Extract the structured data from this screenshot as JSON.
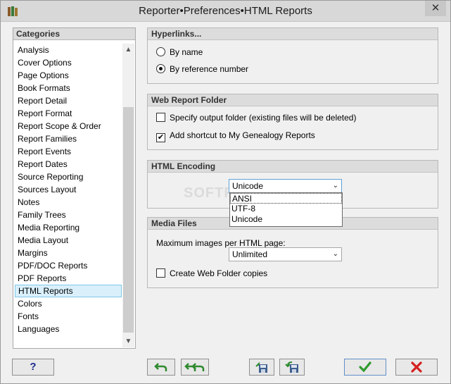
{
  "window": {
    "title": "Reporter•Preferences•HTML Reports",
    "close_label": "✕"
  },
  "categories": {
    "header": "Categories",
    "items": [
      "Analysis",
      "Cover Options",
      "Page Options",
      "Book Formats",
      "Report Detail",
      "Report Format",
      "Report Scope & Order",
      "Report Families",
      "Report Events",
      "Report Dates",
      "Source Reporting",
      "Sources Layout",
      "Notes",
      "Family Trees",
      "Media Reporting",
      "Media Layout",
      "Margins",
      "PDF/DOC Reports",
      "PDF Reports",
      "HTML Reports",
      "Colors",
      "Fonts",
      "Languages"
    ],
    "selected": "HTML Reports"
  },
  "hyperlinks": {
    "title": "Hyperlinks...",
    "opt_by_name": "By name",
    "opt_by_ref": "By reference number",
    "selected": "By reference number"
  },
  "web_folder": {
    "title": "Web Report Folder",
    "specify_label": "Specify output folder (existing files will be deleted)",
    "specify_checked": false,
    "shortcut_label": "Add shortcut to My Genealogy Reports",
    "shortcut_checked": true
  },
  "encoding": {
    "title": "HTML Encoding",
    "value": "Unicode",
    "options": [
      "ANSI",
      "UTF-8",
      "Unicode"
    ],
    "highlighted": "ANSI"
  },
  "media": {
    "title": "Media Files",
    "max_images_label": "Maximum images per HTML page:",
    "max_images_value": "Unlimited",
    "copies_label": "Create Web Folder copies",
    "copies_checked": false
  },
  "buttons": {
    "help_label": "?"
  },
  "watermark": "SOFTPEDIA",
  "colors": {
    "ok_green": "#2e9a2e",
    "cancel_red": "#d42020",
    "arrow_green": "#2f8a2f",
    "selection_bg": "#d9f0fb"
  }
}
